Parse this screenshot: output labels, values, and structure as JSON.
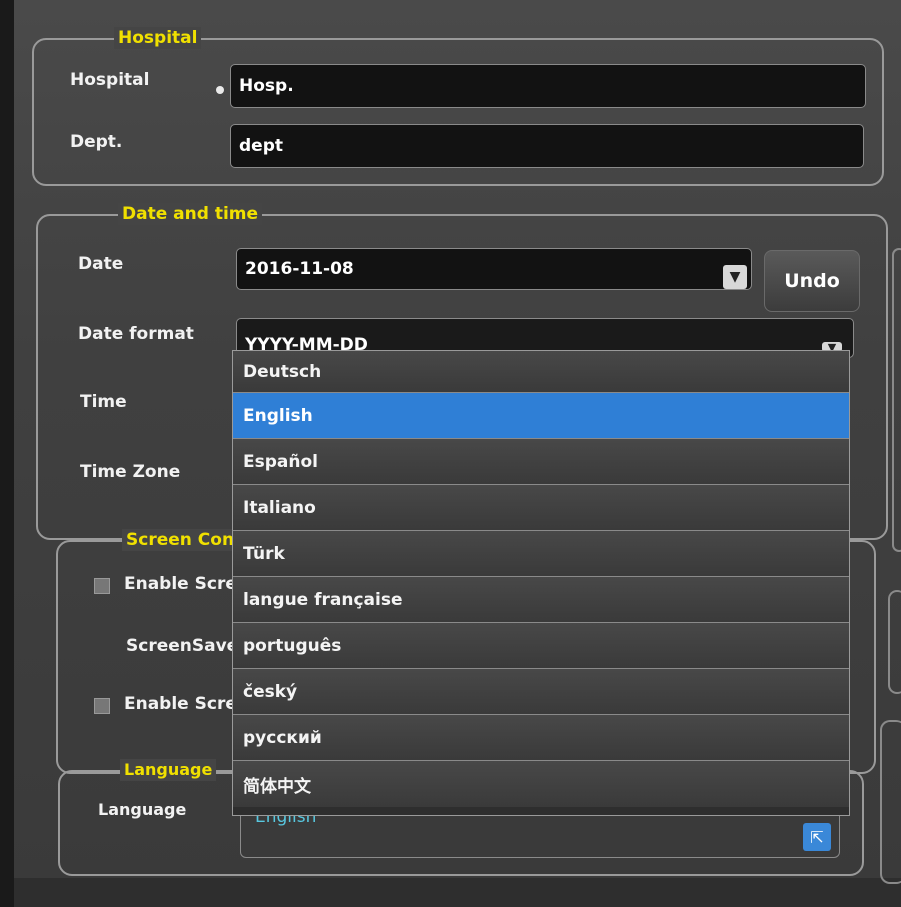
{
  "hospital": {
    "legend": "Hospital",
    "hospital_label": "Hospital",
    "hospital_value": "Hosp.",
    "dept_label": "Dept.",
    "dept_value": "dept"
  },
  "datetime": {
    "legend": "Date and time",
    "date_label": "Date",
    "date_value": "2016-11-08",
    "undo_label": "Undo",
    "date_format_label": "Date format",
    "date_format_value": "YYYY-MM-DD",
    "time_label": "Time",
    "timezone_label": "Time Zone"
  },
  "screen_control": {
    "legend": "Screen Cont",
    "enable_saver_label": "Enable Scree",
    "screensaver_label": "ScreenSaver",
    "enable_other_label": "Enable Scree"
  },
  "language": {
    "legend": "Language",
    "label": "Language",
    "value": "English"
  },
  "dropdown": {
    "options": [
      "Deutsch",
      "English",
      "Español",
      "Italiano",
      "Türk",
      "langue française",
      "português",
      "český",
      "русский",
      "简体中文"
    ],
    "selected_index": 1
  },
  "icons": {
    "dropdown_arrow": "▼",
    "cursor": "⇱"
  }
}
